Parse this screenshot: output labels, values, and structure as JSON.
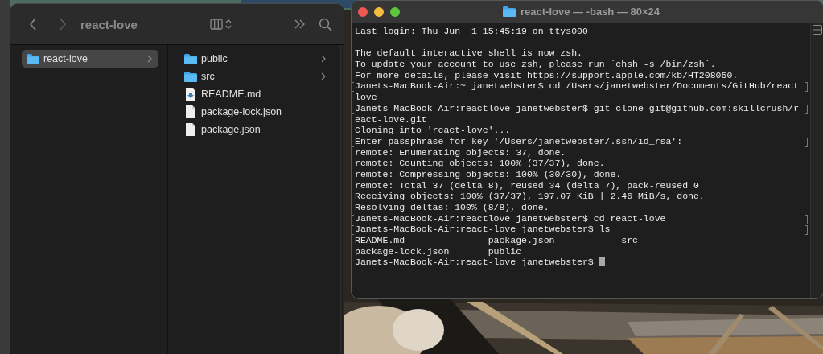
{
  "finder": {
    "title": "react-love",
    "sidebar": [
      {
        "label": "react-love",
        "selected": true
      }
    ],
    "files": [
      {
        "name": "public",
        "kind": "folder"
      },
      {
        "name": "src",
        "kind": "folder"
      },
      {
        "name": "README.md",
        "kind": "markdown"
      },
      {
        "name": "package-lock.json",
        "kind": "document"
      },
      {
        "name": "package.json",
        "kind": "document"
      }
    ]
  },
  "terminal": {
    "title": "react-love — -bash — 80×24",
    "lines": [
      {
        "kind": "text",
        "text": "Last login: Thu Jun  1 15:45:19 on ttys000",
        "mark": false
      },
      {
        "kind": "blank",
        "mark": false
      },
      {
        "kind": "text",
        "text": "The default interactive shell is now zsh.",
        "mark": false
      },
      {
        "kind": "text",
        "text": "To update your account to use zsh, please run `chsh -s /bin/zsh`.",
        "mark": false
      },
      {
        "kind": "text",
        "text": "For more details, please visit https://support.apple.com/kb/HT208050.",
        "mark": false
      },
      {
        "kind": "text",
        "text": "Janets-MacBook-Air:~ janetwebster$ cd /Users/janetwebster/Documents/GitHub/react",
        "mark": true
      },
      {
        "kind": "text",
        "text": "love",
        "mark": false
      },
      {
        "kind": "text",
        "text": "Janets-MacBook-Air:reactlove janetwebster$ git clone git@github.com:skillcrush/r",
        "mark": true
      },
      {
        "kind": "text",
        "text": "eact-love.git",
        "mark": false
      },
      {
        "kind": "text",
        "text": "Cloning into 'react-love'...",
        "mark": false
      },
      {
        "kind": "text",
        "text": "Enter passphrase for key '/Users/janetwebster/.ssh/id_rsa':",
        "mark": true
      },
      {
        "kind": "text",
        "text": "remote: Enumerating objects: 37, done.",
        "mark": false
      },
      {
        "kind": "text",
        "text": "remote: Counting objects: 100% (37/37), done.",
        "mark": false
      },
      {
        "kind": "text",
        "text": "remote: Compressing objects: 100% (30/30), done.",
        "mark": false
      },
      {
        "kind": "text",
        "text": "remote: Total 37 (delta 8), reused 34 (delta 7), pack-reused 0",
        "mark": false
      },
      {
        "kind": "text",
        "text": "Receiving objects: 100% (37/37), 197.07 KiB | 2.46 MiB/s, done.",
        "mark": false
      },
      {
        "kind": "text",
        "text": "Resolving deltas: 100% (8/8), done.",
        "mark": false
      },
      {
        "kind": "text",
        "text": "Janets-MacBook-Air:reactlove janetwebster$ cd react-love",
        "mark": true
      },
      {
        "kind": "text",
        "text": "Janets-MacBook-Air:react-love janetwebster$ ls",
        "mark": true
      },
      {
        "kind": "text",
        "text": "README.md               package.json            src",
        "mark": false
      },
      {
        "kind": "text",
        "text": "package-lock.json       public",
        "mark": false
      },
      {
        "kind": "prompt",
        "text": "Janets-MacBook-Air:react-love janetwebster$",
        "mark": false
      }
    ]
  }
}
